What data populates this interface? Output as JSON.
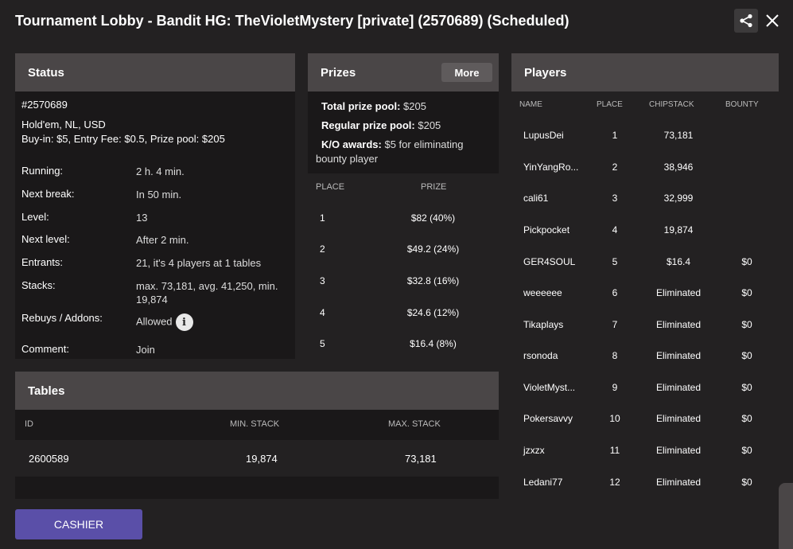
{
  "title": "Tournament Lobby - Bandit HG: TheVioletMystery [private] (2570689) (Scheduled)",
  "status": {
    "header": "Status",
    "id": "#2570689",
    "game": "Hold'em, NL, USD",
    "buyin": "Buy-in: $5, Entry Fee: $0.5, Prize pool: $205",
    "rows": [
      {
        "label": "Running:",
        "value": "2 h. 4 min."
      },
      {
        "label": "Next break:",
        "value": "In 50 min."
      },
      {
        "label": "Level:",
        "value": "13"
      },
      {
        "label": "Next level:",
        "value": "After 2 min."
      },
      {
        "label": "Entrants:",
        "value": "21, it's 4 players at 1 tables"
      },
      {
        "label": "Stacks:",
        "value": "max. 73,181, avg. 41,250, min. 19,874"
      },
      {
        "label": "Rebuys / Addons:",
        "value": "Allowed"
      },
      {
        "label": "Comment:",
        "value": "Join"
      }
    ],
    "info_glyph": "i"
  },
  "prizes": {
    "header": "Prizes",
    "more_label": "More",
    "total_label": "Total prize pool:",
    "total_value": "$205",
    "regular_label": "Regular prize pool:",
    "regular_value": "$205",
    "ko_label": "K/O awards:",
    "ko_value": "$5 for eliminating",
    "ko_value_2": "bounty player",
    "col_place": "PLACE",
    "col_prize": "PRIZE",
    "rows": [
      {
        "place": "1",
        "prize": "$82 (40%)"
      },
      {
        "place": "2",
        "prize": "$49.2 (24%)"
      },
      {
        "place": "3",
        "prize": "$32.8 (16%)"
      },
      {
        "place": "4",
        "prize": "$24.6 (12%)"
      },
      {
        "place": "5",
        "prize": "$16.4 (8%)"
      }
    ]
  },
  "players": {
    "header": "Players",
    "col_name": "NAME",
    "col_place": "PLACE",
    "col_chipstack": "CHIPSTACK",
    "col_bounty": "BOUNTY",
    "rows": [
      {
        "name": "LupusDei",
        "place": "1",
        "chipstack": "73,181",
        "bounty": ""
      },
      {
        "name": "YinYangRo...",
        "place": "2",
        "chipstack": "38,946",
        "bounty": ""
      },
      {
        "name": "cali61",
        "place": "3",
        "chipstack": "32,999",
        "bounty": ""
      },
      {
        "name": "Pickpocket",
        "place": "4",
        "chipstack": "19,874",
        "bounty": ""
      },
      {
        "name": "GER4SOUL",
        "place": "5",
        "chipstack": "$16.4",
        "bounty": "$0"
      },
      {
        "name": "weeeeee",
        "place": "6",
        "chipstack": "Eliminated",
        "bounty": "$0"
      },
      {
        "name": "Tikaplays",
        "place": "7",
        "chipstack": "Eliminated",
        "bounty": "$0"
      },
      {
        "name": "rsonoda",
        "place": "8",
        "chipstack": "Eliminated",
        "bounty": "$0"
      },
      {
        "name": "VioletMyst...",
        "place": "9",
        "chipstack": "Eliminated",
        "bounty": "$0"
      },
      {
        "name": "Pokersavvy",
        "place": "10",
        "chipstack": "Eliminated",
        "bounty": "$0"
      },
      {
        "name": "jzxzx",
        "place": "11",
        "chipstack": "Eliminated",
        "bounty": "$0"
      },
      {
        "name": "Ledani77",
        "place": "12",
        "chipstack": "Eliminated",
        "bounty": "$0"
      }
    ]
  },
  "tables": {
    "header": "Tables",
    "col_id": "ID",
    "col_min": "MIN. STACK",
    "col_max": "MAX. STACK",
    "rows": [
      {
        "id": "2600589",
        "min": "19,874",
        "max": "73,181"
      }
    ]
  },
  "cashier_label": "CASHIER",
  "colors": {
    "background": "#232122",
    "panel_header": "#4a4647",
    "panel_body": "#1a1819",
    "cashier": "#5a4fa8"
  },
  "icons": [
    "share-icon",
    "close-icon",
    "info-icon"
  ]
}
